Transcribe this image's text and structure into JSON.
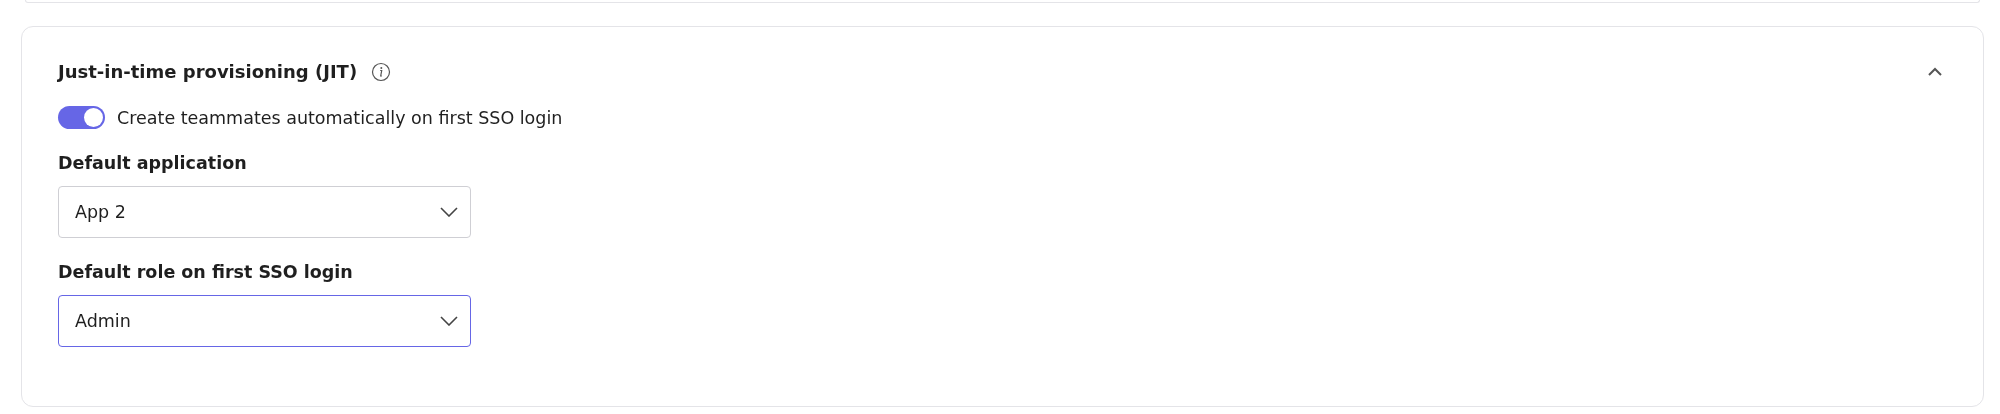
{
  "section": {
    "title": "Just-in-time provisioning (JIT)",
    "expanded": true,
    "toggle": {
      "label": "Create teammates automatically on first SSO login",
      "on": true
    },
    "fields": [
      {
        "label": "Default application",
        "value": "App 2",
        "focused": false
      },
      {
        "label": "Default role on first SSO login",
        "value": "Admin",
        "focused": true
      }
    ]
  }
}
